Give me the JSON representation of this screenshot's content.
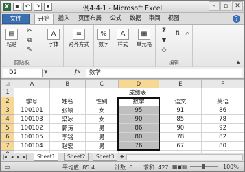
{
  "title": "例4-4-1 - Microsoft Excel",
  "qat": {
    "save_icon": "save-icon",
    "undo_icon": "undo-icon",
    "redo_icon": "redo-icon"
  },
  "window_controls": {
    "minimize": "–",
    "restore": "▫",
    "close": "✕"
  },
  "tabs": [
    {
      "label": "文件"
    },
    {
      "label": "开始"
    },
    {
      "label": "插入"
    },
    {
      "label": "页面布局"
    },
    {
      "label": "公式"
    },
    {
      "label": "数据"
    },
    {
      "label": "审阅"
    },
    {
      "label": "视图"
    }
  ],
  "ribbon": {
    "paste": "粘贴",
    "font": "字体",
    "alignment": "对齐方式",
    "number": "数字",
    "styles": "样式",
    "cells": "单元格",
    "clipboard_group": "剪贴板",
    "editing_group": "编辑",
    "sigma": "Σ",
    "percent": "%"
  },
  "formula_bar": {
    "name_box": "D2",
    "fx": "fx",
    "content": "数学"
  },
  "columns": [
    "A",
    "B",
    "C",
    "D",
    "E",
    "F"
  ],
  "rows": [
    {
      "n": "1",
      "cells": [
        "",
        "",
        "成绩表",
        "",
        "",
        ""
      ]
    },
    {
      "n": "2",
      "cells": [
        "学号",
        "姓名",
        "性别",
        "数学",
        "语文",
        "英语"
      ]
    },
    {
      "n": "3",
      "cells": [
        "100101",
        "张颖",
        "女",
        "95",
        "91",
        "86"
      ]
    },
    {
      "n": "4",
      "cells": [
        "100103",
        "梁冰",
        "女",
        "90",
        "85",
        "78"
      ]
    },
    {
      "n": "5",
      "cells": [
        "100102",
        "郭涛",
        "男",
        "86",
        "90",
        "92"
      ]
    },
    {
      "n": "6",
      "cells": [
        "100105",
        "李铭",
        "男",
        "80",
        "78",
        "82"
      ]
    },
    {
      "n": "7",
      "cells": [
        "100104",
        "赵宏",
        "男",
        "76",
        "67",
        "80"
      ]
    },
    {
      "n": "8",
      "cells": [
        "",
        "",
        "",
        "",
        "",
        ""
      ]
    }
  ],
  "sheets": [
    "Sheet1",
    "Sheet2",
    "Sheet3"
  ],
  "status": {
    "average": "平均值: 85.4",
    "count": "计数: 6",
    "sum": "求和: 427",
    "zoom": "100%"
  }
}
